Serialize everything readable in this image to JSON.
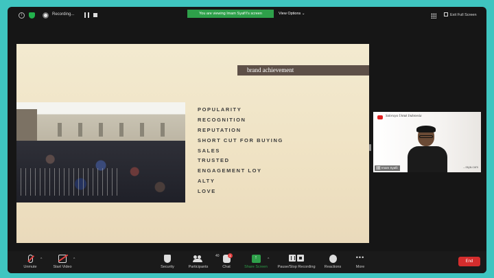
{
  "topbar": {
    "recording_label": "Recording...",
    "viewing_banner": "You are viewing Imam Syafi'i's screen",
    "view_options_label": "View Options ⌄",
    "exit_fullscreen_label": "Exit Full Screen"
  },
  "slide": {
    "title": "brand achievement",
    "items": [
      "POPULARITY",
      "RECOGNITION",
      "REPUTATION",
      "SHORT CUT FOR BUYING",
      "SALES",
      "TRUSTED",
      "ENGAGEMENT LOY",
      "ALTY",
      "LOVE"
    ]
  },
  "video_tile": {
    "caption": "Saloraya Untuk Indonesia",
    "name": "Imam Syafii",
    "url": "...raya.com"
  },
  "toolbar": {
    "unmute": "Unmute",
    "start_video": "Start Video",
    "security": "Security",
    "participants": "Participants",
    "participants_count": "40",
    "chat": "Chat",
    "chat_badge": "1",
    "share_screen": "Share Screen",
    "pause_stop_recording": "Pause/Stop Recording",
    "reactions": "Reactions",
    "more": "More",
    "end": "End"
  },
  "colors": {
    "background": "#3fc5c0",
    "share_green": "#2ea04a",
    "end_red": "#d42d2d"
  }
}
